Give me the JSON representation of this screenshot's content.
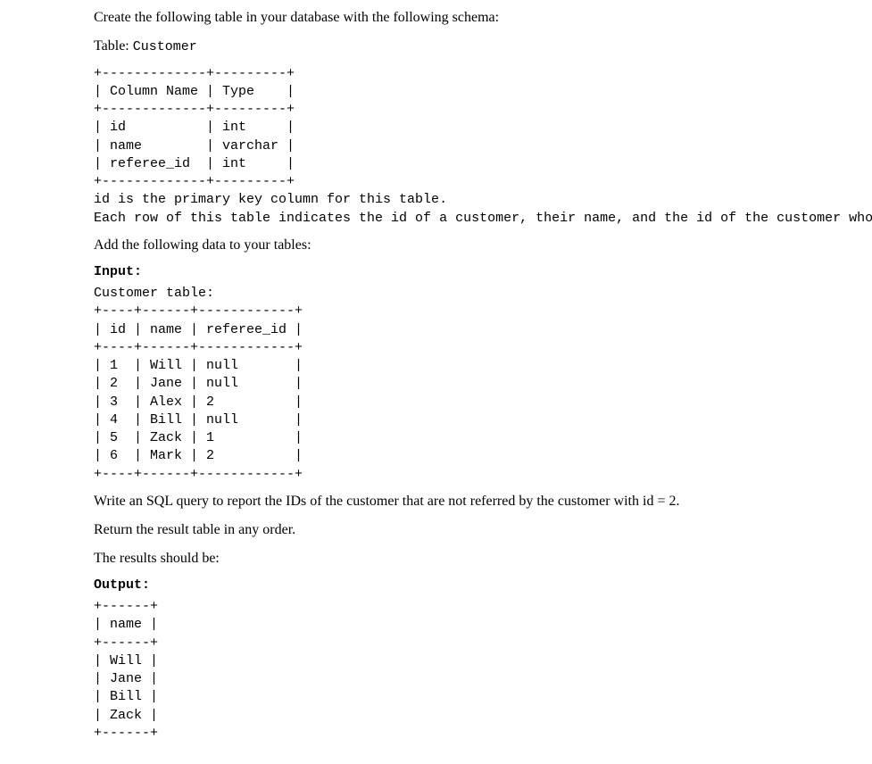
{
  "intro": "Create the following table in your database with the following schema:",
  "table_label": "Table: ",
  "table_name": "Customer",
  "schema_text": "+-------------+---------+\n| Column Name | Type    |\n+-------------+---------+\n| id          | int     |\n| name        | varchar |\n| referee_id  | int     |\n+-------------+---------+\nid is the primary key column for this table.\nEach row of this table indicates the id of a customer, their name, and the id of the customer who referred them.",
  "add_data": "Add the following data to your tables:",
  "input_label": "Input:",
  "input_text": "Customer table:\n+----+------+------------+\n| id | name | referee_id |\n+----+------+------------+\n| 1  | Will | null       |\n| 2  | Jane | null       |\n| 3  | Alex | 2          |\n| 4  | Bill | null       |\n| 5  | Zack | 1          |\n| 6  | Mark | 2          |\n+----+------+------------+",
  "query_prompt": "Write an SQL query to report the IDs of the customer that are not referred by the customer with id = 2.",
  "return_order": "Return the result table in any order.",
  "results_intro": "The results should be:",
  "output_label": "Output:",
  "output_text": "+------+\n| name |\n+------+\n| Will |\n| Jane |\n| Bill |\n| Zack |\n+------+",
  "chart_data": {
    "type": "table",
    "tables": [
      {
        "name": "Customer schema",
        "columns": [
          "Column Name",
          "Type"
        ],
        "rows": [
          [
            "id",
            "int"
          ],
          [
            "name",
            "varchar"
          ],
          [
            "referee_id",
            "int"
          ]
        ]
      },
      {
        "name": "Customer input",
        "columns": [
          "id",
          "name",
          "referee_id"
        ],
        "rows": [
          [
            1,
            "Will",
            null
          ],
          [
            2,
            "Jane",
            null
          ],
          [
            3,
            "Alex",
            2
          ],
          [
            4,
            "Bill",
            null
          ],
          [
            5,
            "Zack",
            1
          ],
          [
            6,
            "Mark",
            2
          ]
        ]
      },
      {
        "name": "Output",
        "columns": [
          "name"
        ],
        "rows": [
          [
            "Will"
          ],
          [
            "Jane"
          ],
          [
            "Bill"
          ],
          [
            "Zack"
          ]
        ]
      }
    ]
  }
}
